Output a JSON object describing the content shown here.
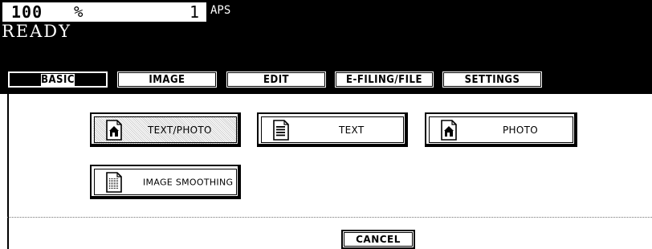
{
  "status": {
    "zoom_value": "100",
    "zoom_unit": "%",
    "copy_count": "1",
    "paper_mode": "APS",
    "message": "READY"
  },
  "tabs": [
    {
      "label": "BASIC",
      "active": true
    },
    {
      "label": "IMAGE",
      "active": false
    },
    {
      "label": "EDIT",
      "active": false
    },
    {
      "label": "E-FILING/FILE",
      "active": false
    },
    {
      "label": "SETTINGS",
      "active": false
    }
  ],
  "modes": {
    "text_photo": {
      "label": "TEXT/PHOTO",
      "selected": true,
      "icon": "document-photo-icon"
    },
    "text": {
      "label": "TEXT",
      "selected": false,
      "icon": "document-text-icon"
    },
    "photo": {
      "label": "PHOTO",
      "selected": false,
      "icon": "document-house-icon"
    },
    "image_smoothing": {
      "label": "IMAGE SMOOTHING",
      "selected": false,
      "icon": "document-smoothing-icon"
    }
  },
  "actions": {
    "cancel_label": "CANCEL"
  },
  "colors": {
    "background": "#ffffff",
    "header": "#000000",
    "text": "#000000"
  }
}
